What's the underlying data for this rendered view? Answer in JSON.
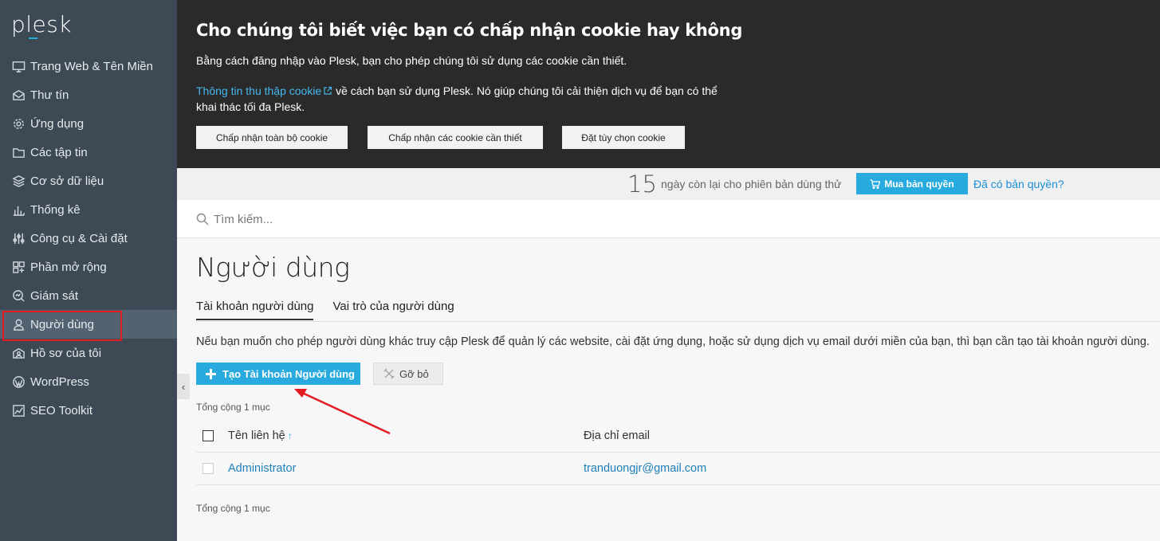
{
  "brand": {
    "logo": "plesk"
  },
  "sidebar": {
    "items": [
      {
        "label": "Trang Web & Tên Miền",
        "icon": "monitor-icon"
      },
      {
        "label": "Thư tín",
        "icon": "mail-icon"
      },
      {
        "label": "Ứng dụng",
        "icon": "gear-icon"
      },
      {
        "label": "Các tập tin",
        "icon": "folder-icon"
      },
      {
        "label": "Cơ sở dữ liệu",
        "icon": "database-icon"
      },
      {
        "label": "Thống kê",
        "icon": "bar-chart-icon"
      },
      {
        "label": "Công cụ & Cài đặt",
        "icon": "sliders-icon"
      },
      {
        "label": "Phần mở rộng",
        "icon": "extensions-icon"
      },
      {
        "label": "Giám sát",
        "icon": "monitoring-icon"
      },
      {
        "label": "Người dùng",
        "icon": "user-icon",
        "active": true
      },
      {
        "label": "Hồ sơ của tôi",
        "icon": "profile-icon"
      },
      {
        "label": "WordPress",
        "icon": "wordpress-icon"
      },
      {
        "label": "SEO Toolkit",
        "icon": "seo-icon"
      }
    ],
    "collapse_glyph": "‹"
  },
  "cookie": {
    "title": "Cho chúng tôi biết việc bạn có chấp nhận cookie hay không",
    "line1": "Bằng cách đăng nhập vào Plesk, bạn cho phép chúng tôi sử dụng các cookie cần thiết.",
    "link": "Thông tin thu thập cookie",
    "line2_rest": " về cách bạn sử dụng Plesk. Nó giúp chúng tôi cải thiện dịch vụ để bạn có thể khai thác tối đa Plesk.",
    "btn_accept_all": "Chấp nhận toàn bộ cookie",
    "btn_accept_necessary": "Chấp nhận các cookie cần thiết",
    "btn_customize": "Đặt tùy chọn cookie"
  },
  "trial": {
    "days": "15",
    "text": "ngày còn lại cho phiên bản dùng thử",
    "buy": "Mua bản quyền",
    "have_license": "Đã có bản quyền?"
  },
  "search": {
    "placeholder": "Tìm kiếm..."
  },
  "page": {
    "title": "Người dùng",
    "tabs": [
      {
        "label": "Tài khoản người dùng",
        "active": true
      },
      {
        "label": "Vai trò của người dùng",
        "active": false
      }
    ],
    "description": "Nếu bạn muốn cho phép người dùng khác truy cập Plesk để quản lý các website, cài đặt ứng dụng, hoặc sử dụng dịch vụ email dưới miền của bạn, thì bạn cần tạo tài khoản người dùng.",
    "create_btn": "Tạo Tài khoản Người dùng",
    "remove_btn": "Gỡ bỏ",
    "total_top": "Tổng cộng 1 mục",
    "total_bottom": "Tổng cộng 1 mục"
  },
  "table": {
    "columns": [
      "Tên liên hệ",
      "Địa chỉ email"
    ],
    "sort_glyph": "↑",
    "rows": [
      {
        "name": "Administrator",
        "email": "tranduongjr@gmail.com"
      }
    ]
  },
  "colors": {
    "accent": "#28aade",
    "sidebar": "#3d4a56",
    "annotation": "#e31b23"
  }
}
